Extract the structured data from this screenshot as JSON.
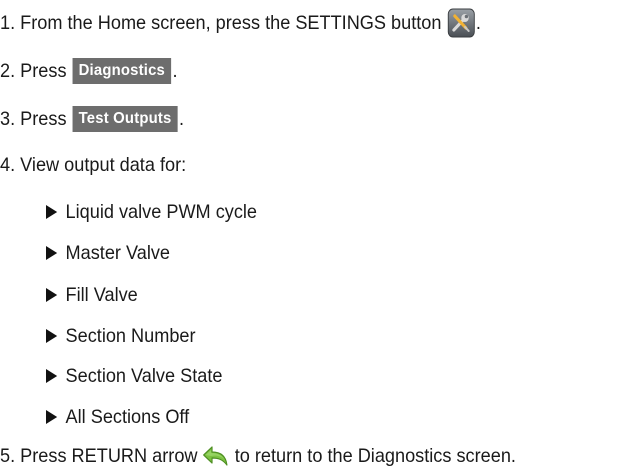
{
  "steps": {
    "s1": {
      "text": "1. From the Home screen, press the SETTINGS button",
      "end": "."
    },
    "s2": {
      "text": "2. Press",
      "button": "Diagnostics",
      "end": "."
    },
    "s3": {
      "text": "3. Press",
      "button": "Test Outputs",
      "end": "."
    },
    "s4": {
      "text": "4. View output data for:"
    },
    "bullets": [
      "Liquid valve PWM cycle",
      "Master Valve",
      "Fill Valve",
      "Section Number",
      "Section Valve State",
      "All Sections Off"
    ],
    "s5": {
      "text_before": "5. Press RETURN arrow",
      "text_after": "to return to the Diagnostics screen."
    }
  },
  "icons": {
    "settings": "settings-tools-icon",
    "return": "return-arrow-icon"
  },
  "colors": {
    "button_bg": "#6d6d6d",
    "return_arrow": "#7cc242"
  }
}
